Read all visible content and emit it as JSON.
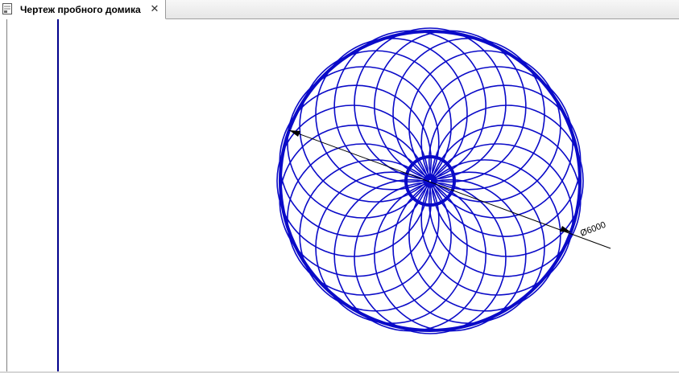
{
  "tab": {
    "title": "Чертеж пробного домика",
    "close_glyph": "✕",
    "icon": "drawing-document-icon"
  },
  "drawing": {
    "dimension_label": "Ø6000",
    "line_color": "#0a0ac8",
    "frame_color": "#00008b",
    "dimension_color": "#000000",
    "petal_count": 24
  }
}
